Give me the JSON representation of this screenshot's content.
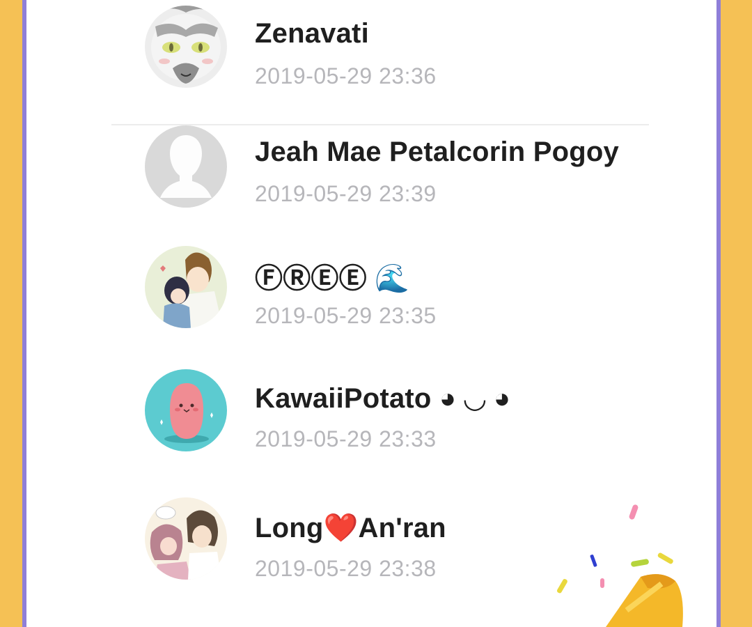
{
  "comments": [
    {
      "name": "Zenavati",
      "time": "2019-05-29 23:36",
      "avatar_icon": "cat-avatar-icon"
    },
    {
      "name": "Jeah Mae Petalcorin Pogoy",
      "time": "2019-05-29 23:39",
      "avatar_icon": "default-avatar-icon"
    },
    {
      "name": "ⒻⓇⒺⒺ 🌊",
      "time": "2019-05-29 23:35",
      "avatar_icon": "anime-couple-avatar-icon"
    },
    {
      "name": "KawaiiPotato ◕ ◡ ◕",
      "time": "2019-05-29 23:33",
      "avatar_icon": "potato-avatar-icon"
    },
    {
      "name": "Long❤️An'ran",
      "time": "2019-05-29 23:38",
      "avatar_icon": "anime-pair-avatar-icon"
    }
  ],
  "decoration": {
    "icon": "party-popper-icon"
  },
  "colors": {
    "frame": "#F5C155",
    "border": "#8F7FD8",
    "name_text": "#1F1F1F",
    "time_text": "#B6B6BA"
  }
}
